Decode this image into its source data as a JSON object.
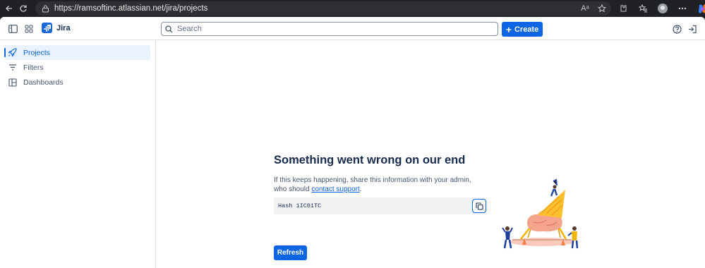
{
  "browser": {
    "url": "https://ramsoftinc.atlassian.net/jira/projects",
    "read_aloud_label": "Aᵃ"
  },
  "app": {
    "name": "Jira",
    "search": {
      "placeholder": "Search"
    },
    "create_label": "Create",
    "colors": {
      "primary": "#0c66e4",
      "text": "#172b4d",
      "subtle": "#44546f",
      "active_bg": "#e9f2ff"
    }
  },
  "sidebar": {
    "items": [
      {
        "label": "Projects",
        "icon": "rocket-icon",
        "active": true
      },
      {
        "label": "Filters",
        "icon": "filter-icon",
        "active": false
      },
      {
        "label": "Dashboards",
        "icon": "dashboard-icon",
        "active": false
      }
    ]
  },
  "error": {
    "title": "Something went wrong on our end",
    "description_prefix": "If this keeps happening, share this information with your admin, who should ",
    "link_text": "contact support",
    "description_suffix": ".",
    "hash": "Hash 1IC01TC",
    "refresh_label": "Refresh"
  }
}
